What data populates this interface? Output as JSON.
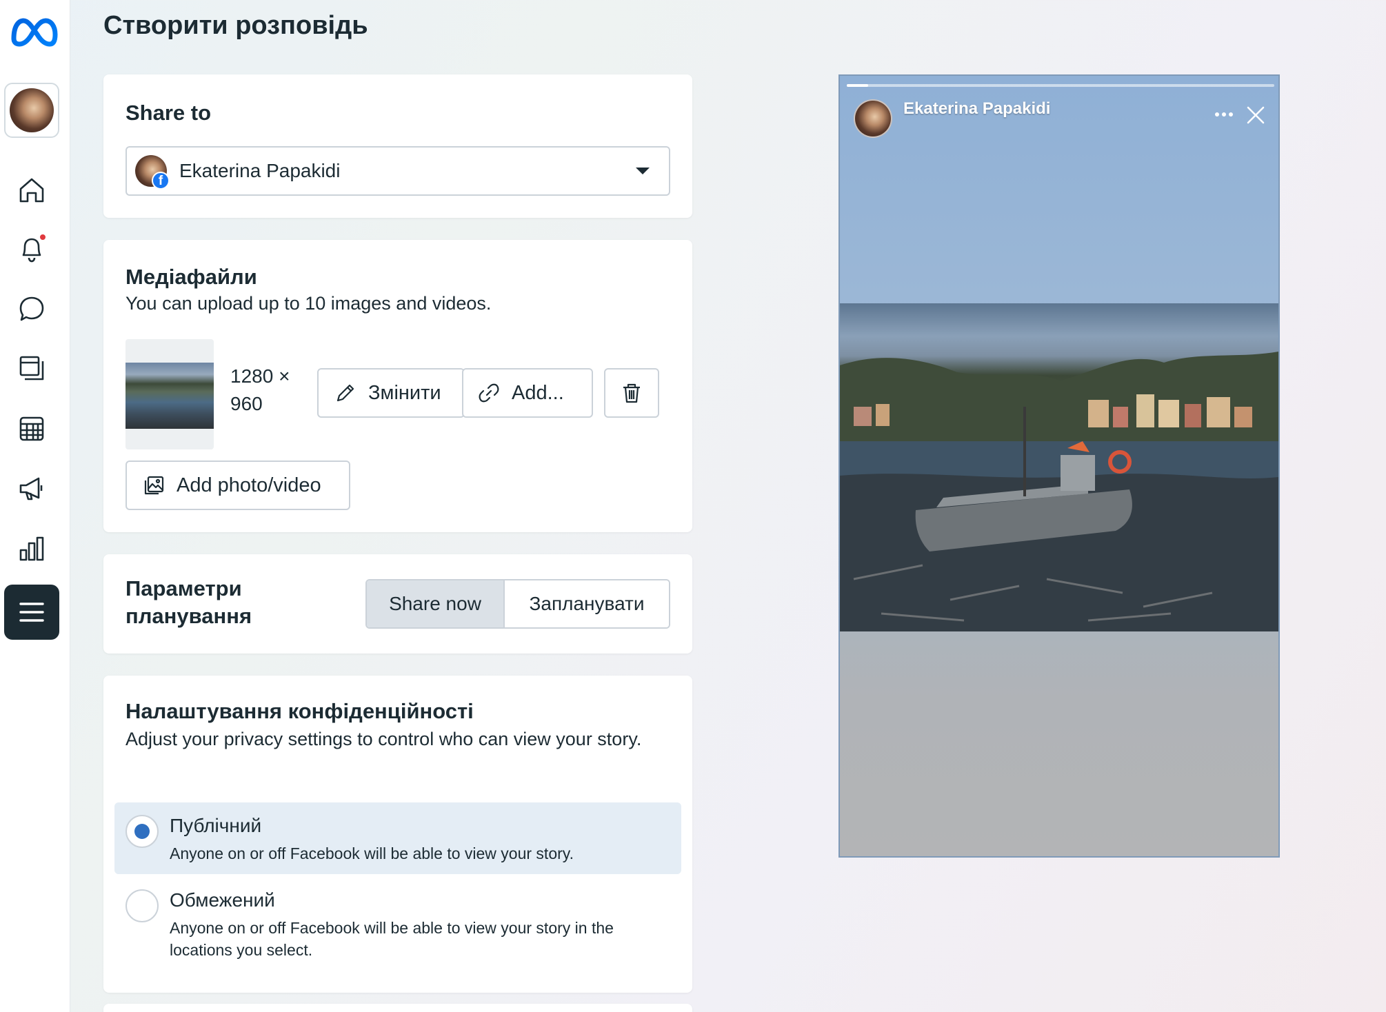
{
  "page_title": "Створити розповідь",
  "share_to": {
    "title": "Share to",
    "selected_account": "Ekaterina Papakidi"
  },
  "media": {
    "title": "Медіафайли",
    "subtitle": "You can upload up to 10 images and videos.",
    "file_dims_line1": "1280 ×",
    "file_dims_line2": "960",
    "edit_label": "Змінити",
    "add_link_label": "Add...",
    "add_photo_label": "Add photo/video"
  },
  "scheduling": {
    "title_line1": "Параметри",
    "title_line2": "планування",
    "options": [
      "Share now",
      "Запланувати"
    ],
    "selected": "Share now"
  },
  "privacy": {
    "title": "Налаштування конфіденційності",
    "subtitle": "Adjust your privacy settings to control who can view your story.",
    "options": [
      {
        "label": "Публічний",
        "description": "Anyone on or off Facebook will be able to view your story.",
        "selected": true
      },
      {
        "label": "Обмежений",
        "description": "Anyone on or off Facebook will be able to view your story in the locations you select.",
        "selected": false
      }
    ]
  },
  "preview": {
    "author": "Ekaterina Papakidi",
    "progress": 0.05
  },
  "sidebar": {
    "items": [
      "home-icon",
      "notifications-icon",
      "messages-icon",
      "content-icon",
      "planner-icon",
      "ads-icon",
      "insights-icon",
      "menu-icon"
    ],
    "has_notification": true
  },
  "colors": {
    "accent": "#2f6fc0",
    "facebook_blue": "#1877f2",
    "notification": "#e0393e",
    "text": "#1c2b33"
  }
}
